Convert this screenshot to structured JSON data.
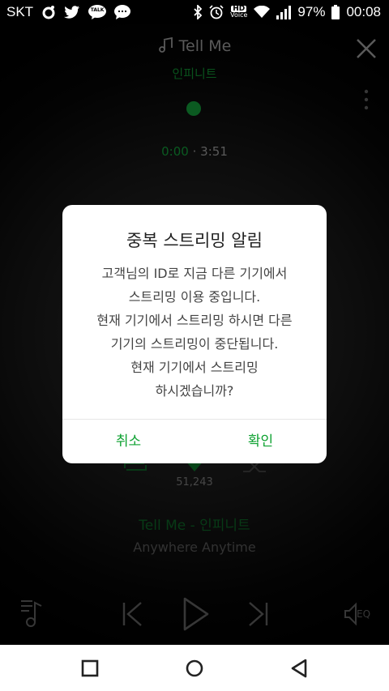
{
  "status_bar": {
    "carrier": "SKT",
    "left_icons": [
      "app-o-icon",
      "twitter-icon",
      "kakaotalk-icon",
      "chat-bubble-icon"
    ],
    "talk_label": "TALK",
    "hd_label": "HD",
    "voice_label": "Voice",
    "battery": "97%",
    "time": "00:08"
  },
  "player": {
    "title": "Tell Me",
    "artist": "인피니트",
    "time_current": "0:00",
    "time_separator": "·",
    "time_total": "3:51",
    "like_count": "51,243",
    "song_line": "Tell Me - 인피니트",
    "album": "Anywhere Anytime",
    "eq_label": "EQ",
    "accent_color": "#108a33"
  },
  "dialog": {
    "title": "중복 스트리밍 알림",
    "body_lines": [
      "고객님의 ID로 지금 다른 기기에서",
      "스트리밍 이용 중입니다.",
      "현재 기기에서 스트리밍 하시면 다른",
      "기기의 스트리밍이 중단됩니다.",
      "현재 기기에서 스트리밍",
      "하시겠습니까?"
    ],
    "cancel_label": "취소",
    "confirm_label": "확인",
    "button_color": "#0fa232"
  },
  "nav_bar": {
    "icons": [
      "recent-apps-icon",
      "home-icon",
      "back-icon"
    ]
  }
}
